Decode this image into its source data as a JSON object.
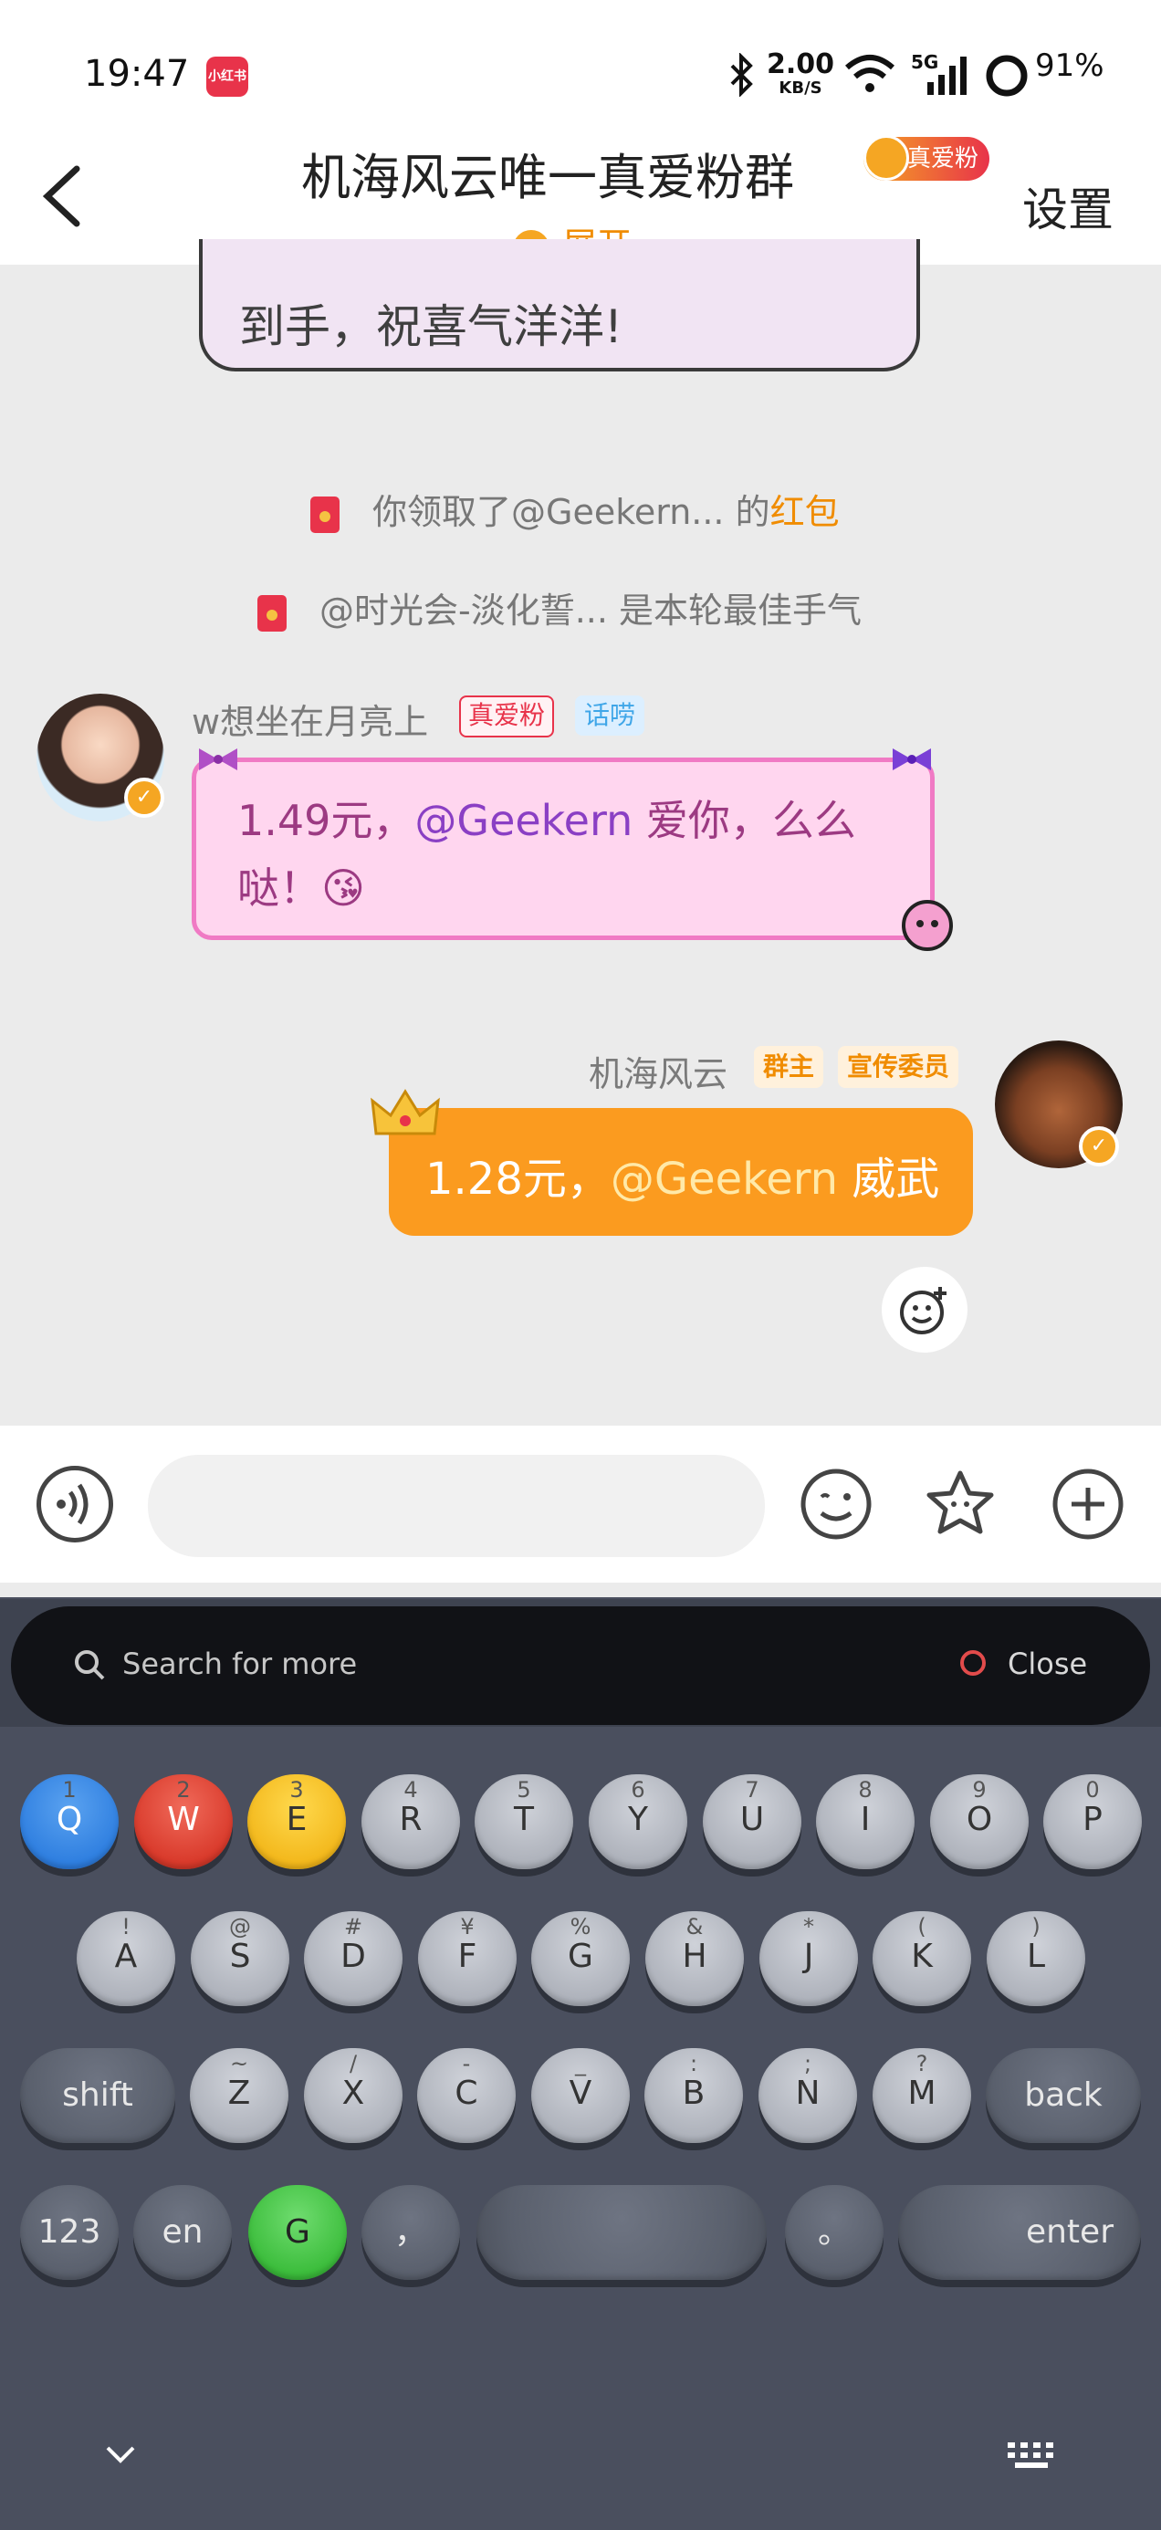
{
  "status_bar": {
    "time": "19:47",
    "app_badge": "小红书",
    "net_speed_value": "2.00",
    "net_speed_unit": "KB/S",
    "network": "5G",
    "battery": "91%"
  },
  "header": {
    "title": "机海风云唯一真爱粉群",
    "fan_badge": "真爱粉",
    "settings": "设置",
    "expand": "展开"
  },
  "chat": {
    "prev_bubble_text": "到手，祝喜气洋洋!",
    "system_1": {
      "before": "你领取了@Geekern... 的",
      "highlight": "红包"
    },
    "system_2": "@时光会-淡化誓... 是本轮最佳手气",
    "msg_left": {
      "sender": "w想坐在月亮上",
      "tag1": "真爱粉",
      "tag2": "话唠",
      "line1_amount": "1.49元，",
      "line1_mention": "@Geekern",
      "line1_rest": " 爱你，么么",
      "line2": "哒！😘"
    },
    "msg_right": {
      "sender": "机海风云",
      "tag1": "群主",
      "tag2": "宣传委员",
      "amount": "1.28元，",
      "mention": "@Geekern",
      "rest": " 威武"
    }
  },
  "keyboard": {
    "search_placeholder": "Search for more",
    "close": "Close",
    "row1": [
      {
        "sub": "1",
        "main": "Q"
      },
      {
        "sub": "2",
        "main": "W"
      },
      {
        "sub": "3",
        "main": "E"
      },
      {
        "sub": "4",
        "main": "R"
      },
      {
        "sub": "5",
        "main": "T"
      },
      {
        "sub": "6",
        "main": "Y"
      },
      {
        "sub": "7",
        "main": "U"
      },
      {
        "sub": "8",
        "main": "I"
      },
      {
        "sub": "9",
        "main": "O"
      },
      {
        "sub": "0",
        "main": "P"
      }
    ],
    "row2": [
      {
        "sub": "!",
        "main": "A"
      },
      {
        "sub": "@",
        "main": "S"
      },
      {
        "sub": "#",
        "main": "D"
      },
      {
        "sub": "¥",
        "main": "F"
      },
      {
        "sub": "%",
        "main": "G"
      },
      {
        "sub": "&",
        "main": "H"
      },
      {
        "sub": "*",
        "main": "J"
      },
      {
        "sub": "(",
        "main": "K"
      },
      {
        "sub": ")",
        "main": "L"
      }
    ],
    "row3": [
      {
        "sub": "~",
        "main": "Z"
      },
      {
        "sub": "/",
        "main": "X"
      },
      {
        "sub": "-",
        "main": "C"
      },
      {
        "sub": "_",
        "main": "V"
      },
      {
        "sub": ":",
        "main": "B"
      },
      {
        "sub": ";",
        "main": "N"
      },
      {
        "sub": "?",
        "main": "M"
      }
    ],
    "shift": "shift",
    "back": "back",
    "num": "123",
    "lang": "en",
    "g": "G",
    "comma": "，",
    "period": "。",
    "enter": "enter"
  },
  "colors": {
    "accent_orange": "#fb9b1f",
    "brand_red": "#e8334a",
    "pink_bubble": "#ffd6ef"
  }
}
